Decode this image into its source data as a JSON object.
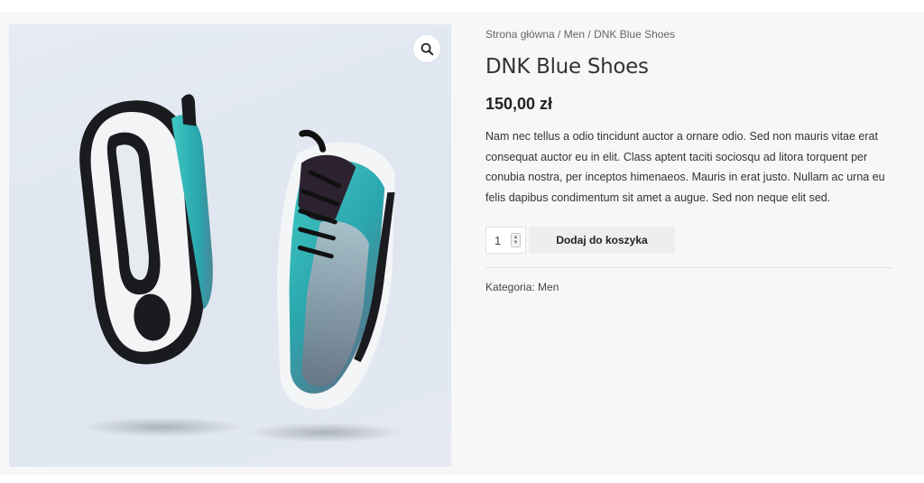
{
  "breadcrumb": {
    "home": "Strona główna",
    "sep1": " / ",
    "category": "Men",
    "sep2": " / ",
    "current": "DNK Blue Shoes"
  },
  "product": {
    "title": "DNK Blue Shoes",
    "price": "150,00 zł",
    "description": "Nam nec tellus a odio tincidunt auctor a ornare odio. Sed non mauris vitae erat consequat auctor eu in elit. Class aptent taciti sociosqu ad litora torquent per conubia nostra, per inceptos himenaeos. Mauris in erat justo. Nullam ac urna eu felis dapibus condimentum sit amet a augue. Sed non neque elit sed.",
    "image_icon": "sneakers-pair"
  },
  "cart": {
    "quantity": "1",
    "add_label": "Dodaj do koszyka"
  },
  "meta": {
    "category_label": "Kategoria:",
    "category_value": "Men"
  },
  "icons": {
    "zoom": "magnifier-icon"
  },
  "colors": {
    "page_bg": "#f7f7f7",
    "button_bg": "#eeeeee",
    "image_bg": "#e2e8f1"
  }
}
